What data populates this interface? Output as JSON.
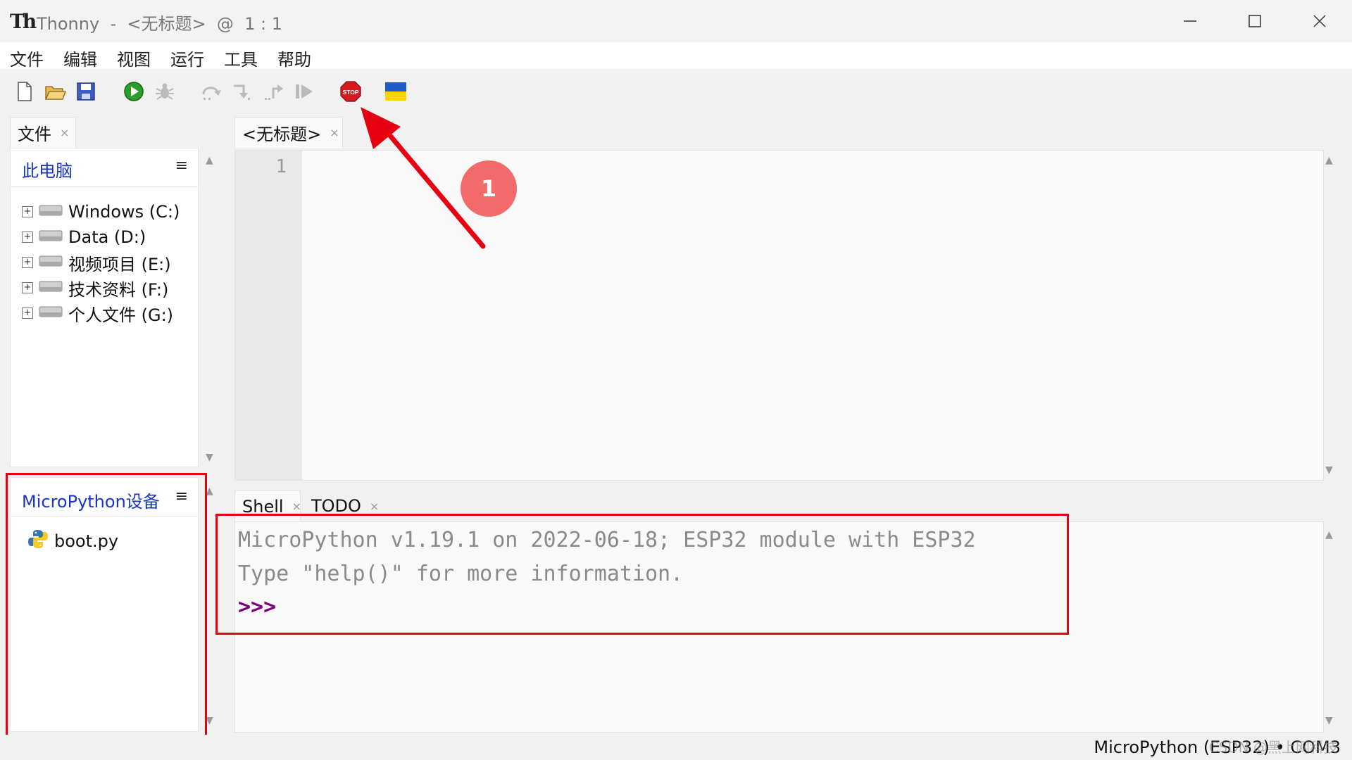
{
  "window": {
    "app_logo": "Th",
    "title": "Thonny  -  <无标题>  @  1 : 1"
  },
  "menu": [
    {
      "label": "文件"
    },
    {
      "label": "编辑"
    },
    {
      "label": "视图"
    },
    {
      "label": "运行"
    },
    {
      "label": "工具"
    },
    {
      "label": "帮助"
    }
  ],
  "toolbar": {
    "icons": [
      "new-file-icon",
      "open-folder-icon",
      "save-icon",
      "run-icon",
      "debug-icon",
      "step-over-icon",
      "step-into-icon",
      "step-out-icon",
      "resume-icon",
      "stop-icon",
      "ukraine-flag-icon"
    ],
    "stop_label": "STOP"
  },
  "files_panel": {
    "tab_label": "文件",
    "close_glyph": "×",
    "section_title": "此电脑",
    "menu_glyph": "≡",
    "drives": [
      {
        "label": "Windows (C:)"
      },
      {
        "label": "Data (D:)"
      },
      {
        "label": "视频项目 (E:)"
      },
      {
        "label": "技术资料 (F:)"
      },
      {
        "label": "个人文件 (G:)"
      }
    ],
    "expand_glyph": "+"
  },
  "device_panel": {
    "section_title": "MicroPython设备",
    "menu_glyph": "≡",
    "files": [
      {
        "label": "boot.py"
      }
    ]
  },
  "editor": {
    "tab_label": "<无标题>",
    "close_glyph": "×",
    "line_numbers": [
      "1"
    ]
  },
  "shell": {
    "tabs": [
      {
        "label": "Shell",
        "close_glyph": "×"
      },
      {
        "label": "TODO",
        "close_glyph": "×"
      }
    ],
    "lines": [
      "MicroPython v1.19.1 on 2022-06-18; ESP32 module with ESP32",
      "Type \"help()\" for more information."
    ],
    "prompt": ">>>"
  },
  "annotation": {
    "badge": "1"
  },
  "status": {
    "interpreter": "MicroPython (ESP32)  •  COM3",
    "watermark": "CSDN @黑上网科技"
  },
  "colors": {
    "accent_blue": "#1a35c0",
    "annotation_red": "#e60012",
    "badge_red": "#f26a6a",
    "prompt_purple": "#7a007a"
  },
  "scroll_glyphs": {
    "up": "▲",
    "down": "▼"
  }
}
